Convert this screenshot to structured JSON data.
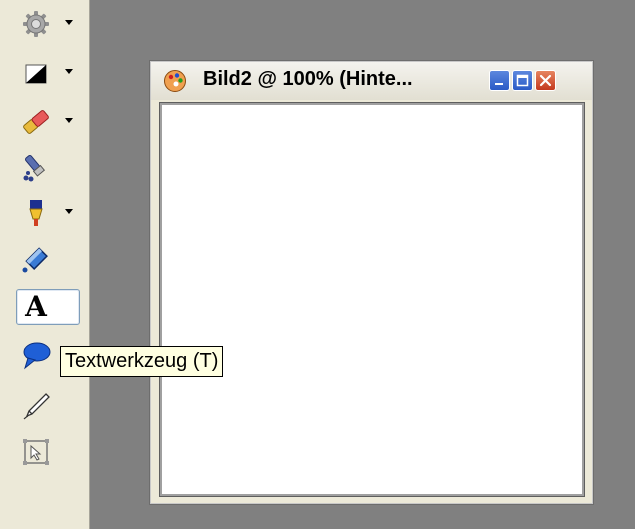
{
  "toolbar": {
    "tools": [
      {
        "name": "gear-tool",
        "icon": "gear-icon",
        "has_arrow": true
      },
      {
        "name": "shape-tool",
        "icon": "shape-triangle-icon",
        "has_arrow": true
      },
      {
        "name": "eraser-tool",
        "icon": "eraser-icon",
        "has_arrow": true
      },
      {
        "name": "brush-tool",
        "icon": "brush-icon",
        "has_arrow": false
      },
      {
        "name": "color-tool",
        "icon": "color-tube-icon",
        "has_arrow": true
      },
      {
        "name": "fill-tool",
        "icon": "paint-bucket-icon",
        "has_arrow": false
      },
      {
        "name": "text-tool",
        "icon": "text-icon",
        "glyph": "A",
        "selected": true
      },
      {
        "name": "speech-bubble-tool",
        "icon": "speech-bubble-icon",
        "has_arrow": false
      },
      {
        "name": "pen-tool",
        "icon": "pen-icon",
        "has_arrow": false
      },
      {
        "name": "transform-tool",
        "icon": "transform-frame-icon",
        "has_arrow": false
      }
    ],
    "text_glyph": "A"
  },
  "tooltip": {
    "text": "Textwerkzeug (T)"
  },
  "document": {
    "title": "Bild2 @ 100% (Hinte...",
    "app_icon": "app-palette-icon",
    "buttons": {
      "minimize": "minimize-icon",
      "maximize": "maximize-icon",
      "close": "close-icon"
    },
    "colors": {
      "canvas": "#ffffff",
      "workspace": "#808080",
      "close": "#c4391e",
      "window_buttons": "#2a5ac6"
    }
  }
}
